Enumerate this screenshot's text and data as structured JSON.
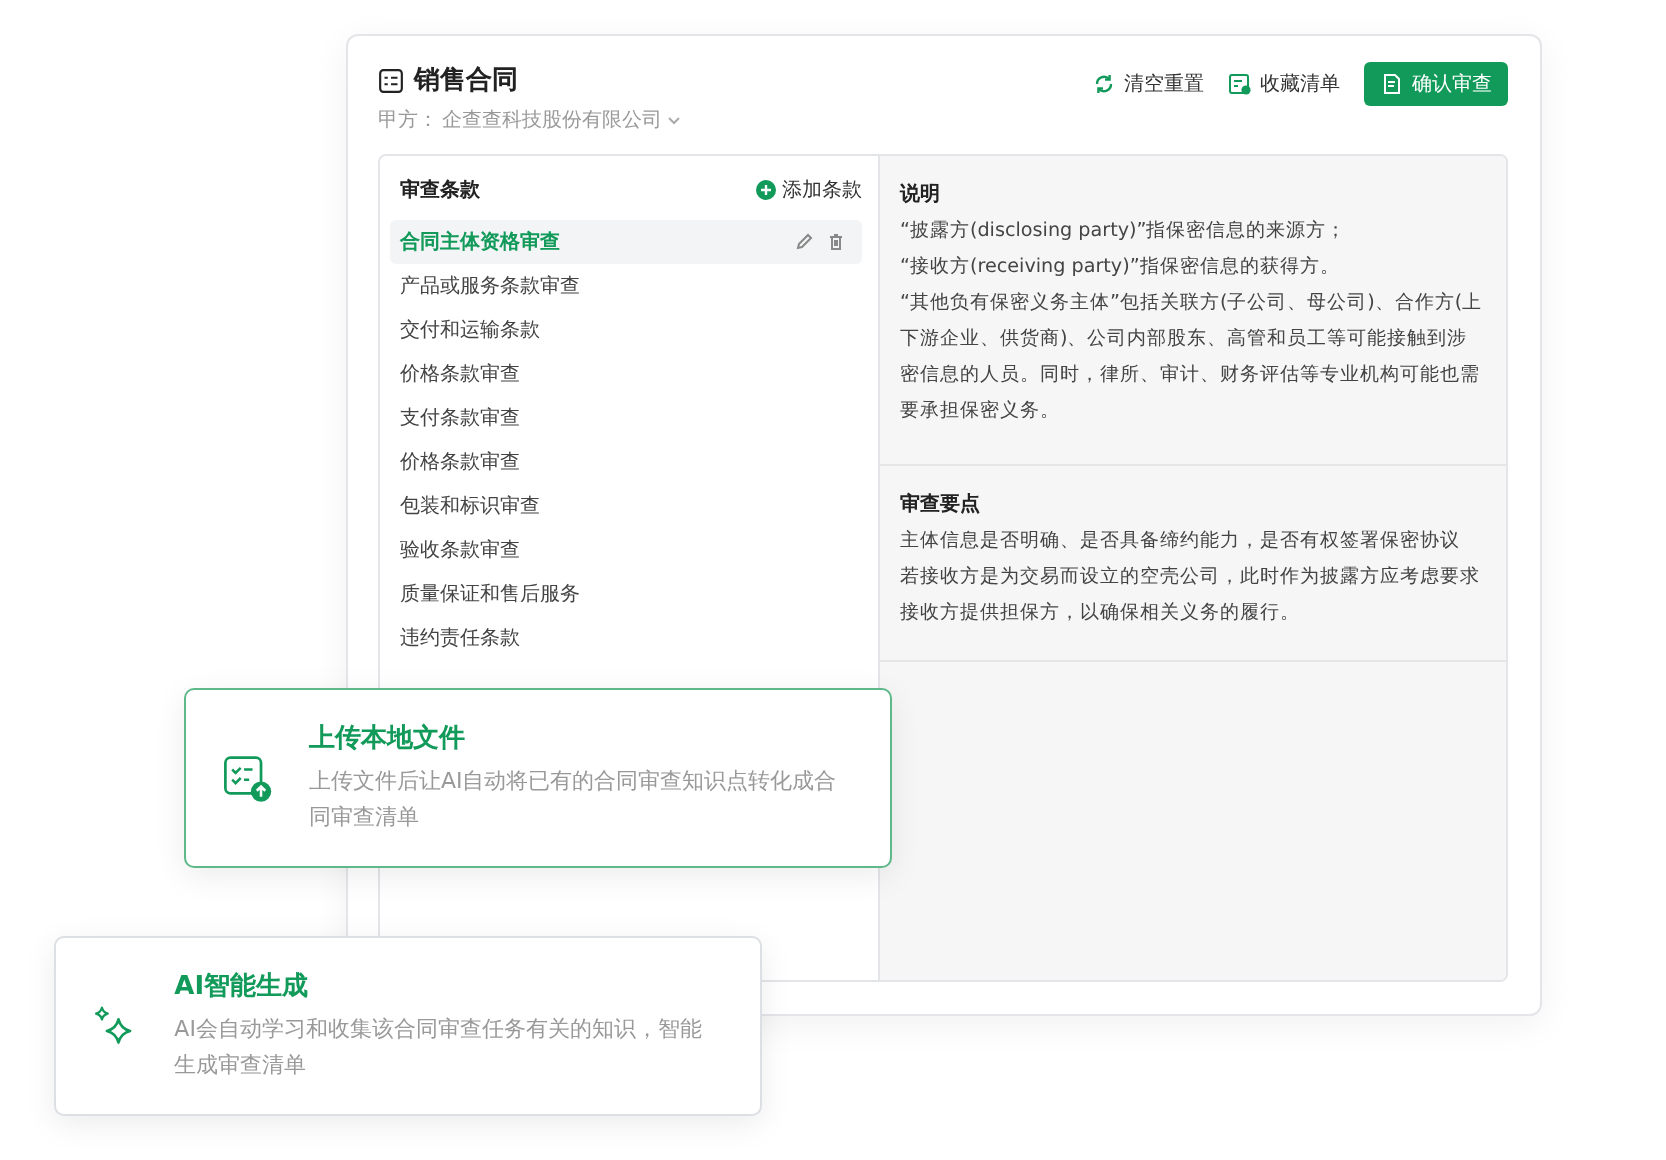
{
  "header": {
    "title": "销售合同",
    "party_label": "甲方：",
    "party_value": "企查查科技股份有限公司",
    "actions": [
      {
        "kind": "reset",
        "label": "清空重置"
      },
      {
        "kind": "favorite",
        "label": "收藏清单"
      },
      {
        "kind": "confirm",
        "label": "确认审查"
      }
    ]
  },
  "clauses": {
    "title": "审查条款",
    "add_label": "添加条款",
    "items": [
      {
        "label": "合同主体资格审查",
        "selected": true
      },
      {
        "label": "产品或服务条款审查",
        "selected": false
      },
      {
        "label": "交付和运输条款",
        "selected": false
      },
      {
        "label": "价格条款审查",
        "selected": false
      },
      {
        "label": "支付条款审查",
        "selected": false
      },
      {
        "label": "价格条款审查",
        "selected": false
      },
      {
        "label": "包装和标识审查",
        "selected": false
      },
      {
        "label": "验收条款审查",
        "selected": false
      },
      {
        "label": "质量保证和售后服务",
        "selected": false
      },
      {
        "label": "违约责任条款",
        "selected": false
      }
    ]
  },
  "sections": [
    {
      "title": "说明",
      "paragraphs": [
        "“披露方(disclosing party)”指保密信息的来源方；",
        "“接收方(receiving party)”指保密信息的获得方。",
        "“其他负有保密义务主体”包括关联方(子公司、母公司)、合作方(上下游企业、供货商)、公司内部股东、高管和员工等可能接触到涉密信息的人员。同时，律所、审计、财务评估等专业机构可能也需要承担保密义务。"
      ]
    },
    {
      "title": "审查要点",
      "paragraphs": [
        "主体信息是否明确、是否具备缔约能力，是否有权签署保密协议",
        "若接收方是为交易而设立的空壳公司，此时作为披露方应考虑要求接收方提供担保方，以确保相关义务的履行。"
      ]
    }
  ],
  "cards": [
    {
      "kind": "upload",
      "title": "上传本地文件",
      "description": "上传文件后让AI自动将已有的合同审查知识点转化成合同审查清单",
      "highlighted": true
    },
    {
      "kind": "ai",
      "title": "AI智能生成",
      "description": "AI会自动学习和收集该合同审查任务有关的知识，智能生成审查清单",
      "highlighted": false
    }
  ]
}
